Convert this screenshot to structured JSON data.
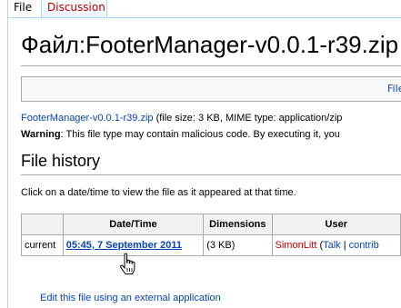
{
  "tabs": {
    "file": "File",
    "discussion": "Discussion"
  },
  "page": {
    "title": "Файл:FooterManager-v0.0.1-r39.zip"
  },
  "filetoc": {
    "link": "File"
  },
  "file_info": {
    "filename_link": "FooterManager-v0.0.1-r39.zip",
    "details": " (file size: 3 KB, MIME type: application/zip"
  },
  "warning": {
    "label": "Warning",
    "text": ": This file type may contain malicious code. By executing it, you"
  },
  "history": {
    "heading": "File history",
    "instructions": "Click on a date/time to view the file as it appeared at that time.",
    "columns": [
      "",
      "Date/Time",
      "Dimensions",
      "User"
    ],
    "rows": [
      {
        "status": "current",
        "datetime": "05:45, 7 September 2011",
        "dimensions": "(3 KB)",
        "user": "SimonLitt",
        "talk_open": " (",
        "talk": "Talk",
        "separator": " | ",
        "contribs": "contrib"
      }
    ]
  },
  "bottom_link": "Edit this file using an external application"
}
